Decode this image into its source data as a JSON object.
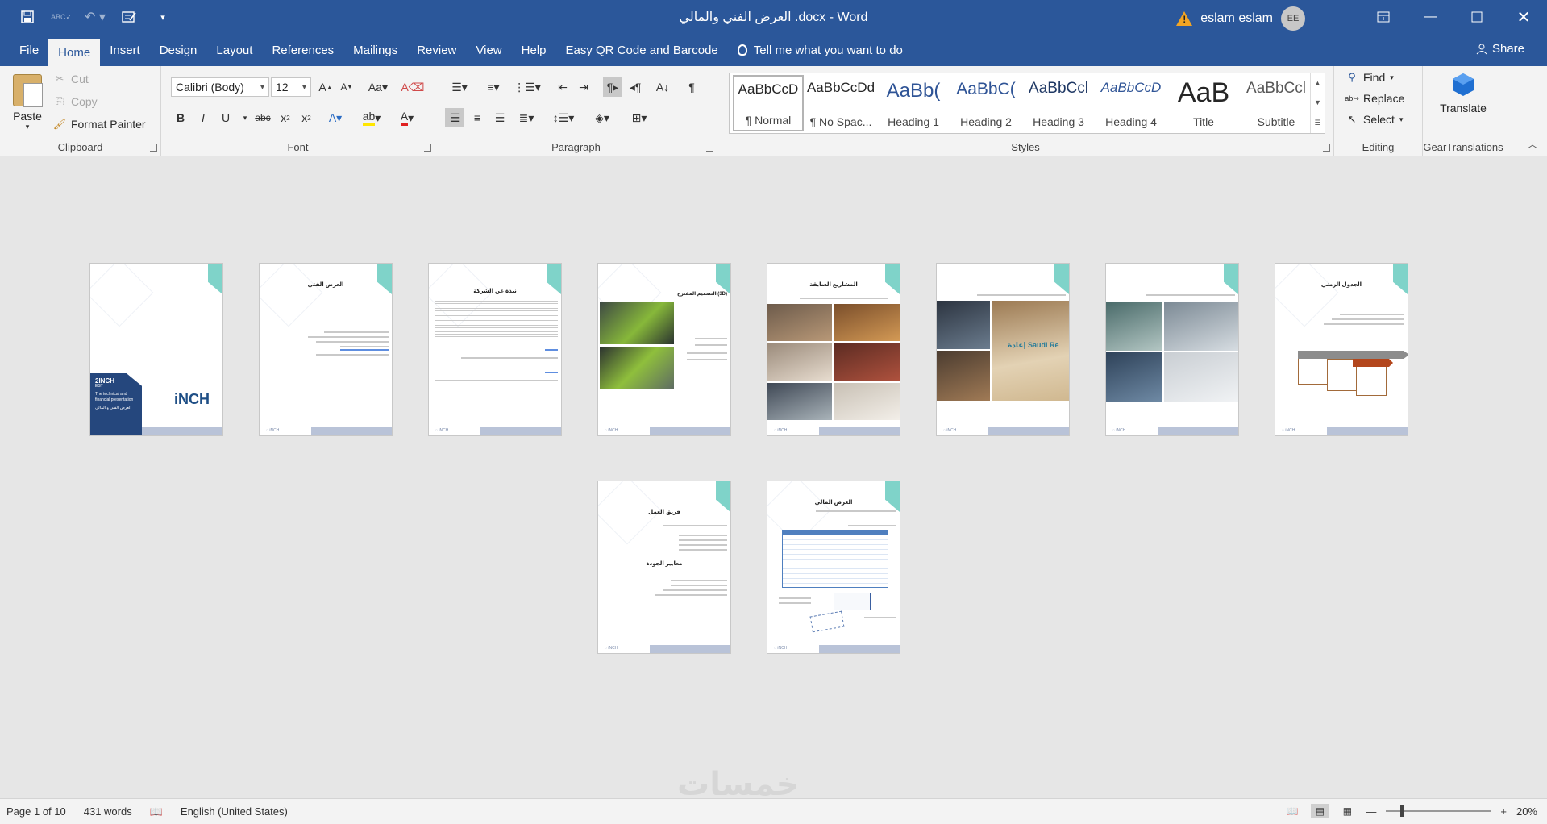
{
  "title_bar": {
    "doc_title": "العرض الفني والمالي .docx  -  Word",
    "user_name": "eslam eslam",
    "avatar_initials": "EE"
  },
  "menu": {
    "tabs": [
      "File",
      "Home",
      "Insert",
      "Design",
      "Layout",
      "References",
      "Mailings",
      "Review",
      "View",
      "Help",
      "Easy QR Code and Barcode"
    ],
    "active_tab": "Home",
    "tell_me": "Tell me what you want to do",
    "share": "Share"
  },
  "ribbon": {
    "clipboard": {
      "label": "Clipboard",
      "paste": "Paste",
      "cut": "Cut",
      "copy": "Copy",
      "format_painter": "Format Painter"
    },
    "font": {
      "label": "Font",
      "font_name": "Calibri (Body)",
      "font_size": "12"
    },
    "paragraph": {
      "label": "Paragraph"
    },
    "styles": {
      "label": "Styles",
      "items": [
        {
          "sample": "AaBbCcD",
          "name": "¶ Normal"
        },
        {
          "sample": "AaBbCcDd",
          "name": "¶ No Spac..."
        },
        {
          "sample": "AaBb(",
          "name": "Heading 1"
        },
        {
          "sample": "AaBbC(",
          "name": "Heading 2"
        },
        {
          "sample": "AaBbCcl",
          "name": "Heading 3"
        },
        {
          "sample": "AaBbCcD",
          "name": "Heading 4"
        },
        {
          "sample": "AaB",
          "name": "Title"
        },
        {
          "sample": "AaBbCcl",
          "name": "Subtitle"
        }
      ]
    },
    "editing": {
      "label": "Editing",
      "find": "Find",
      "replace": "Replace",
      "select": "Select"
    },
    "gear": {
      "label": "GearTranslations",
      "translate": "Translate"
    }
  },
  "pages": {
    "cover": {
      "brand": "2INCH",
      "est": "EST",
      "subtitle": "The technical and financial presentation",
      "arabic_sub": "العرض الفني و المالي",
      "logo": "iNCH"
    },
    "titles": [
      "العرض الفني",
      "نبذة عن الشركة",
      "التصميم المقترح (3D)",
      "المشاريع السابقة",
      "",
      "",
      "الجدول الزمني",
      "فريق العمل",
      "العرض المالي"
    ],
    "quality_heading": "معايير الجودة",
    "saudi_re_sign": "إعادة Saudi Re"
  },
  "status": {
    "page": "Page 1 of 10",
    "words": "431 words",
    "language": "English (United States)",
    "zoom": "20%",
    "watermark": "خمسات"
  }
}
